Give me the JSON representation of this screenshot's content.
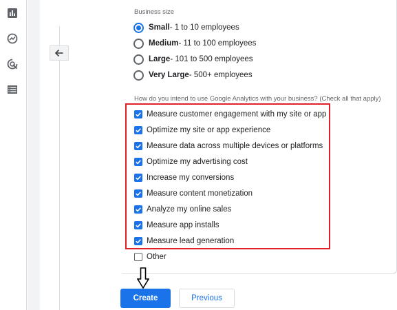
{
  "business_size": {
    "label": "Business size",
    "options": [
      {
        "name": "Small",
        "detail": " - 1 to 10 employees",
        "selected": true
      },
      {
        "name": "Medium",
        "detail": " - 11 to 100 employees",
        "selected": false
      },
      {
        "name": "Large",
        "detail": " - 101 to 500 employees",
        "selected": false
      },
      {
        "name": "Very Large",
        "detail": " - 500+ employees",
        "selected": false
      }
    ]
  },
  "intent": {
    "label": "How do you intend to use Google Analytics with your business? (Check all that apply)",
    "options": [
      {
        "label": "Measure customer engagement with my site or app",
        "checked": true
      },
      {
        "label": "Optimize my site or app experience",
        "checked": true
      },
      {
        "label": "Measure data across multiple devices or platforms",
        "checked": true
      },
      {
        "label": "Optimize my advertising cost",
        "checked": true
      },
      {
        "label": "Increase my conversions",
        "checked": true
      },
      {
        "label": "Measure content monetization",
        "checked": true
      },
      {
        "label": "Analyze my online sales",
        "checked": true
      },
      {
        "label": "Measure app installs",
        "checked": true
      },
      {
        "label": "Measure lead generation",
        "checked": true
      },
      {
        "label": "Other",
        "checked": false
      }
    ]
  },
  "actions": {
    "create_label": "Create",
    "previous_label": "Previous"
  },
  "colors": {
    "accent": "#1a73e8",
    "highlight": "#e0202a",
    "rail_icon": "#5f6368"
  },
  "icons": {
    "rail": [
      "reports-bar-chart-icon",
      "explore-icon",
      "advertising-target-icon",
      "configure-list-icon"
    ],
    "back": "arrow-left-icon",
    "pointer": "down-arrow-pointer-icon"
  }
}
